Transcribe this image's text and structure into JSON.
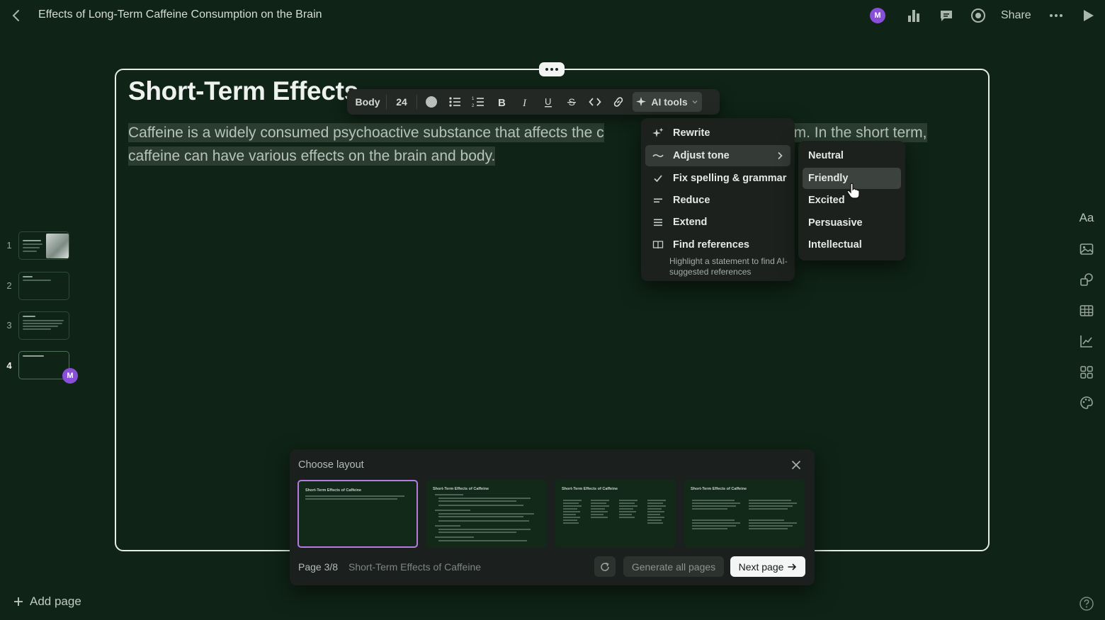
{
  "topbar": {
    "title": "Effects of Long-Term Caffeine Consumption on the Brain",
    "avatar_initial": "M",
    "share_label": "Share"
  },
  "slide": {
    "title": "Short-Term Effects of Caffeine",
    "body_visible_1": "Caffeine is a widely consumed psychoactive substance that affects the c",
    "body_visible_2": "m. In the short term,",
    "body_line_2": "caffeine can have various effects on the brain and body."
  },
  "toolbar": {
    "style_label": "Body",
    "size_label": "24",
    "ai_label": "AI tools"
  },
  "ai_menu": {
    "items": [
      {
        "label": "Rewrite",
        "icon": "sparkle-icon"
      },
      {
        "label": "Adjust tone",
        "icon": "wave-icon"
      },
      {
        "label": "Fix spelling & grammar",
        "icon": "check-icon"
      },
      {
        "label": "Reduce",
        "icon": "reduce-lines-icon"
      },
      {
        "label": "Extend",
        "icon": "extend-lines-icon"
      },
      {
        "label": "Find references",
        "icon": "book-icon"
      }
    ],
    "find_references_sub": "Highlight a statement to find AI-suggested references"
  },
  "tone_menu": {
    "items": [
      "Neutral",
      "Friendly",
      "Excited",
      "Persuasive",
      "Intellectual"
    ],
    "hovered": "Friendly"
  },
  "thumbnails": {
    "numbers": [
      "1",
      "2",
      "3",
      "4"
    ],
    "current": "4",
    "avatar_initial": "M"
  },
  "add_page_label": "Add page",
  "layout_panel": {
    "title": "Choose layout",
    "option_title": "Short-Term Effects of Caffeine",
    "page_label": "Page 3/8",
    "page_name": "Short-Term Effects of Caffeine",
    "generate_all_label": "Generate all pages",
    "next_label": "Next page"
  },
  "colors": {
    "background": "#0f2316",
    "accent_avatar": "#8a4fd8",
    "selected_layout_border": "#b57be0"
  }
}
